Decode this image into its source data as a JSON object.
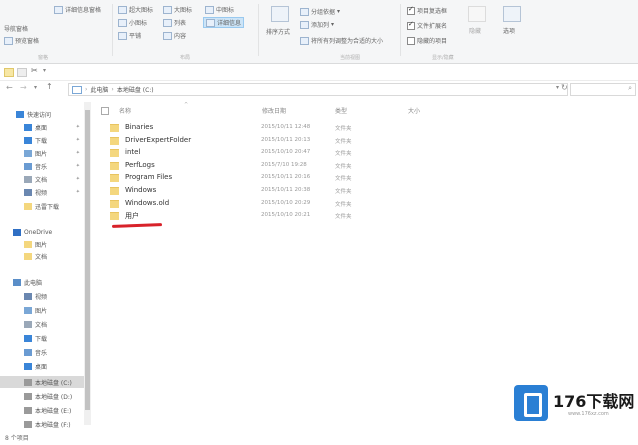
{
  "ribbon": {
    "nav_pane": [
      "导航窗格",
      "预览窗格"
    ],
    "details_pane": "详细信息窗格",
    "layout": [
      "超大图标",
      "大图标",
      "中图标",
      "小图标",
      "列表",
      "详细信息",
      "平铺",
      "内容"
    ],
    "sort": "排序方式",
    "view_opts": [
      "分组依据",
      "添加列",
      "将所有列调整为合适的大小"
    ],
    "show_hide": [
      "项目复选框",
      "文件扩展名",
      "隐藏的项目"
    ],
    "hide_selected": "隐藏",
    "options": "选项",
    "group_labels": [
      "窗格",
      "布局",
      "当前视图",
      "显示/隐藏"
    ]
  },
  "address": {
    "path": [
      "此电脑",
      "本地磁盘 (C:)"
    ]
  },
  "nav": {
    "items": [
      {
        "label": "快速访问",
        "icon": "star-icon"
      },
      {
        "label": "桌面",
        "icon": "desktop-icon"
      },
      {
        "label": "下载",
        "icon": "download-icon"
      },
      {
        "label": "图片",
        "icon": "picture-icon"
      },
      {
        "label": "音乐",
        "icon": "music-icon"
      },
      {
        "label": "文档",
        "icon": "document-icon"
      },
      {
        "label": "视频",
        "icon": "video-icon"
      },
      {
        "label": "迅雷下载",
        "icon": "folder-icon"
      },
      {
        "label": "OneDrive",
        "icon": "cloud-icon"
      },
      {
        "label": "图片",
        "icon": "folder-icon"
      },
      {
        "label": "文档",
        "icon": "folder-icon"
      },
      {
        "label": "此电脑",
        "icon": "computer-icon"
      },
      {
        "label": "视频",
        "icon": "video-icon"
      },
      {
        "label": "图片",
        "icon": "picture-icon"
      },
      {
        "label": "文档",
        "icon": "document-icon"
      },
      {
        "label": "下载",
        "icon": "download-icon"
      },
      {
        "label": "音乐",
        "icon": "music-icon"
      },
      {
        "label": "桌面",
        "icon": "desktop-icon"
      },
      {
        "label": "本地磁盘 (C:)",
        "icon": "drive-icon"
      },
      {
        "label": "本地磁盘 (D:)",
        "icon": "drive-icon"
      },
      {
        "label": "本地磁盘 (E:)",
        "icon": "drive-icon"
      },
      {
        "label": "本地磁盘 (F:)",
        "icon": "drive-icon"
      }
    ]
  },
  "columns": [
    "名称",
    "修改日期",
    "类型",
    "大小"
  ],
  "files": [
    {
      "name": "Binaries",
      "date": "2015/10/11 12:48",
      "type": "文件夹"
    },
    {
      "name": "DriverExpertFolder",
      "date": "2015/10/11 20:13",
      "type": "文件夹"
    },
    {
      "name": "intel",
      "date": "2015/10/10 20:47",
      "type": "文件夹"
    },
    {
      "name": "PerfLogs",
      "date": "2015/7/10 19:28",
      "type": "文件夹"
    },
    {
      "name": "Program Files",
      "date": "2015/10/11 20:16",
      "type": "文件夹"
    },
    {
      "name": "Windows",
      "date": "2015/10/11 20:38",
      "type": "文件夹"
    },
    {
      "name": "Windows.old",
      "date": "2015/10/10 20:29",
      "type": "文件夹"
    },
    {
      "name": "用户",
      "date": "2015/10/10 20:21",
      "type": "文件夹"
    }
  ],
  "status": "8 个项目",
  "watermark": {
    "text": "176下载网",
    "url": "www.176xz.com"
  }
}
